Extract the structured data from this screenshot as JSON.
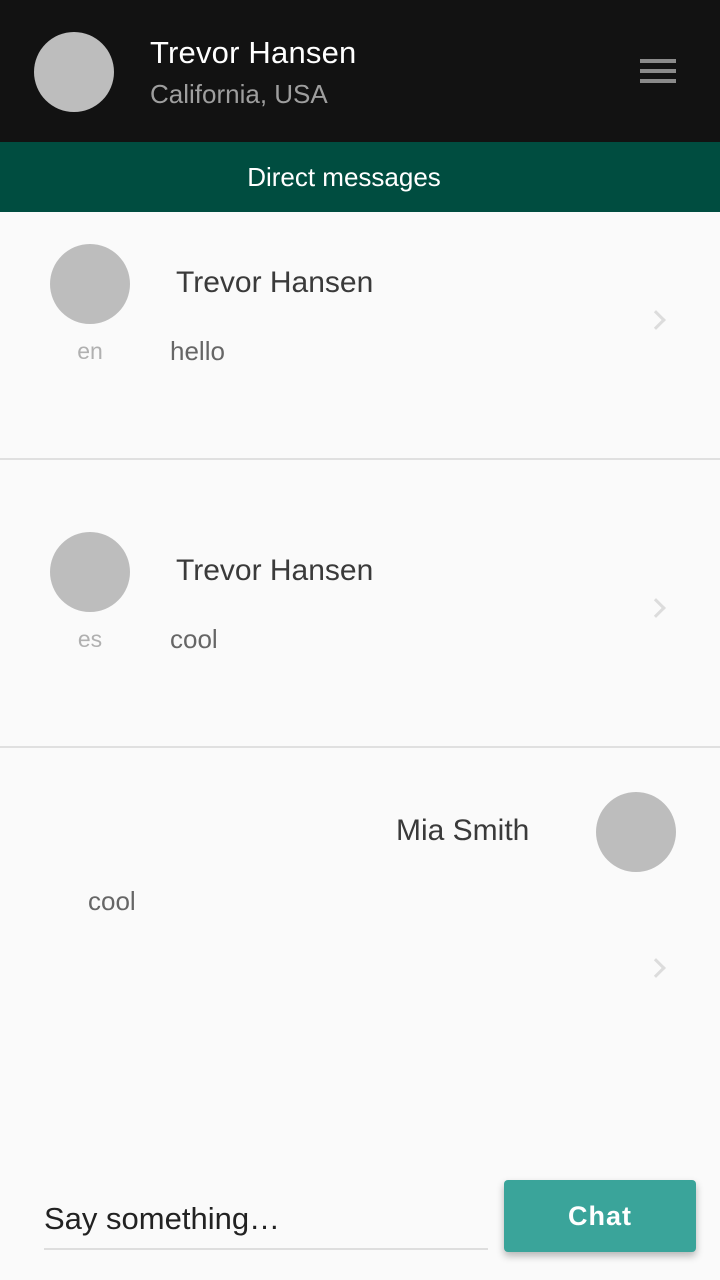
{
  "header": {
    "user_name": "Trevor Hansen",
    "user_location": "California, USA",
    "avatar": "avatar-placeholder",
    "menu_icon": "hamburger-menu-icon"
  },
  "tab": {
    "label": "Direct messages"
  },
  "messages": [
    {
      "name": "Trevor Hansen",
      "text": "hello",
      "lang": "en",
      "align": "left"
    },
    {
      "name": "Trevor Hansen",
      "text": "cool",
      "lang": "es",
      "align": "left"
    },
    {
      "name": "Mia Smith",
      "text": "cool",
      "lang": "",
      "align": "right"
    }
  ],
  "composer": {
    "placeholder": "Say something…",
    "send_label": "Chat"
  },
  "colors": {
    "header_bg": "#121212",
    "tab_bg": "#004d40",
    "accent": "#3aa49a",
    "avatar": "#bdbdbd"
  }
}
